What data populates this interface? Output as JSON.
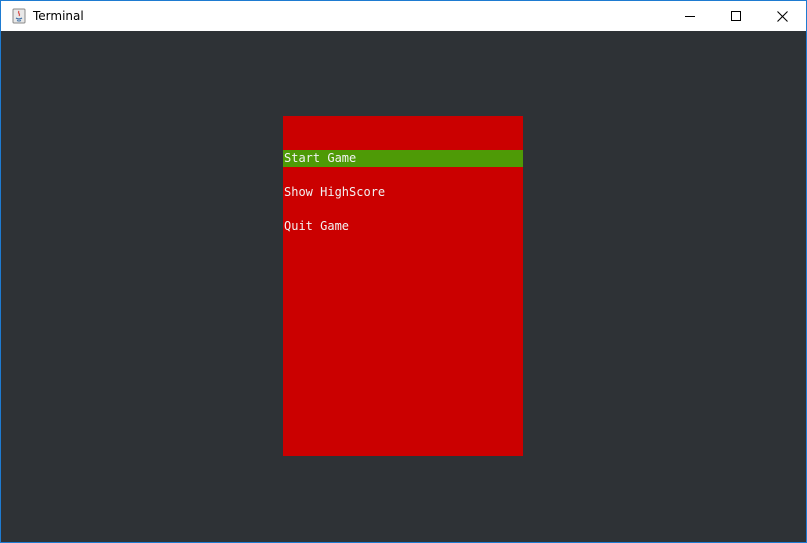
{
  "window": {
    "title": "Terminal",
    "controls": {
      "minimize_icon": "minimize-icon",
      "maximize_icon": "maximize-icon",
      "close_icon": "close-icon"
    }
  },
  "colors": {
    "background": "#2e3236",
    "menu_panel": "#cb0000",
    "selected_item": "#4e9a06",
    "menu_text": "#f2f2f2"
  },
  "menu": {
    "items": [
      {
        "label": "Start Game",
        "selected": true
      },
      {
        "label": "Show HighScore",
        "selected": false
      },
      {
        "label": "Quit Game",
        "selected": false
      }
    ]
  }
}
